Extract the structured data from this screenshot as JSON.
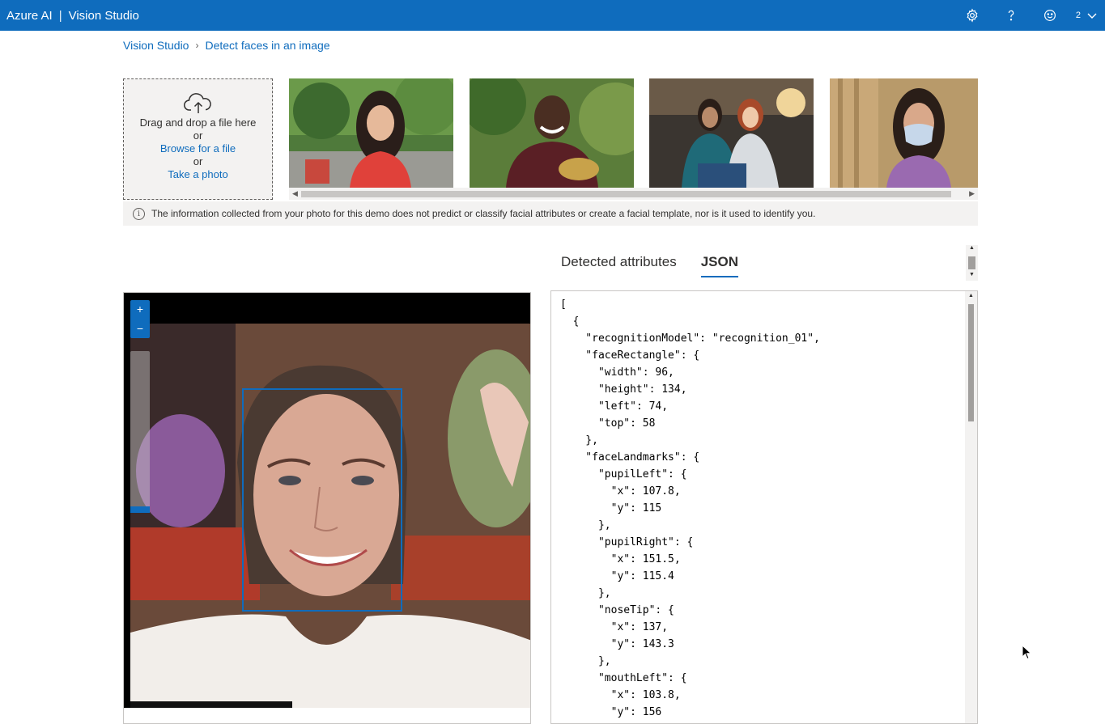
{
  "app": {
    "brand": "Azure AI",
    "separator": "|",
    "product": "Vision Studio",
    "account_badge": "2"
  },
  "icons": {
    "settings": "gear-icon",
    "help": "question-icon",
    "feedback": "smiley-icon",
    "account_menu": "chevron-down-icon",
    "upload": "cloud-upload-icon",
    "info": "info-icon",
    "zoom_in": "plus-icon",
    "zoom_out": "minus-icon"
  },
  "breadcrumb": {
    "root": "Vision Studio",
    "current": "Detect faces in an image"
  },
  "upload": {
    "drag_text": "Drag and drop a file here",
    "or_1": "or",
    "browse_link": "Browse for a file",
    "or_2": "or",
    "photo_link": "Take a photo"
  },
  "gallery": {
    "items": [
      {
        "name": "sample-woman-red-blouse"
      },
      {
        "name": "sample-man-smiling"
      },
      {
        "name": "sample-two-women"
      },
      {
        "name": "sample-woman-mask"
      }
    ]
  },
  "info_banner": "The information collected from your photo for this demo does not predict or classify facial attributes or create a facial template, nor is it used to identify you.",
  "tabs": [
    {
      "label": "Detected attributes",
      "active": false
    },
    {
      "label": "JSON",
      "active": true
    }
  ],
  "viewer": {
    "zoom_in_label": "+",
    "zoom_out_label": "−",
    "zoom_level": 0.0
  },
  "json_output": "[\n  {\n    \"recognitionModel\": \"recognition_01\",\n    \"faceRectangle\": {\n      \"width\": 96,\n      \"height\": 134,\n      \"left\": 74,\n      \"top\": 58\n    },\n    \"faceLandmarks\": {\n      \"pupilLeft\": {\n        \"x\": 107.8,\n        \"y\": 115\n      },\n      \"pupilRight\": {\n        \"x\": 151.5,\n        \"y\": 115.4\n      },\n      \"noseTip\": {\n        \"x\": 137,\n        \"y\": 143.3\n      },\n      \"mouthLeft\": {\n        \"x\": 103.8,\n        \"y\": 156\n      },\n    },",
  "colors": {
    "accent": "#0f6cbd",
    "banner_bg": "#f3f2f1"
  }
}
